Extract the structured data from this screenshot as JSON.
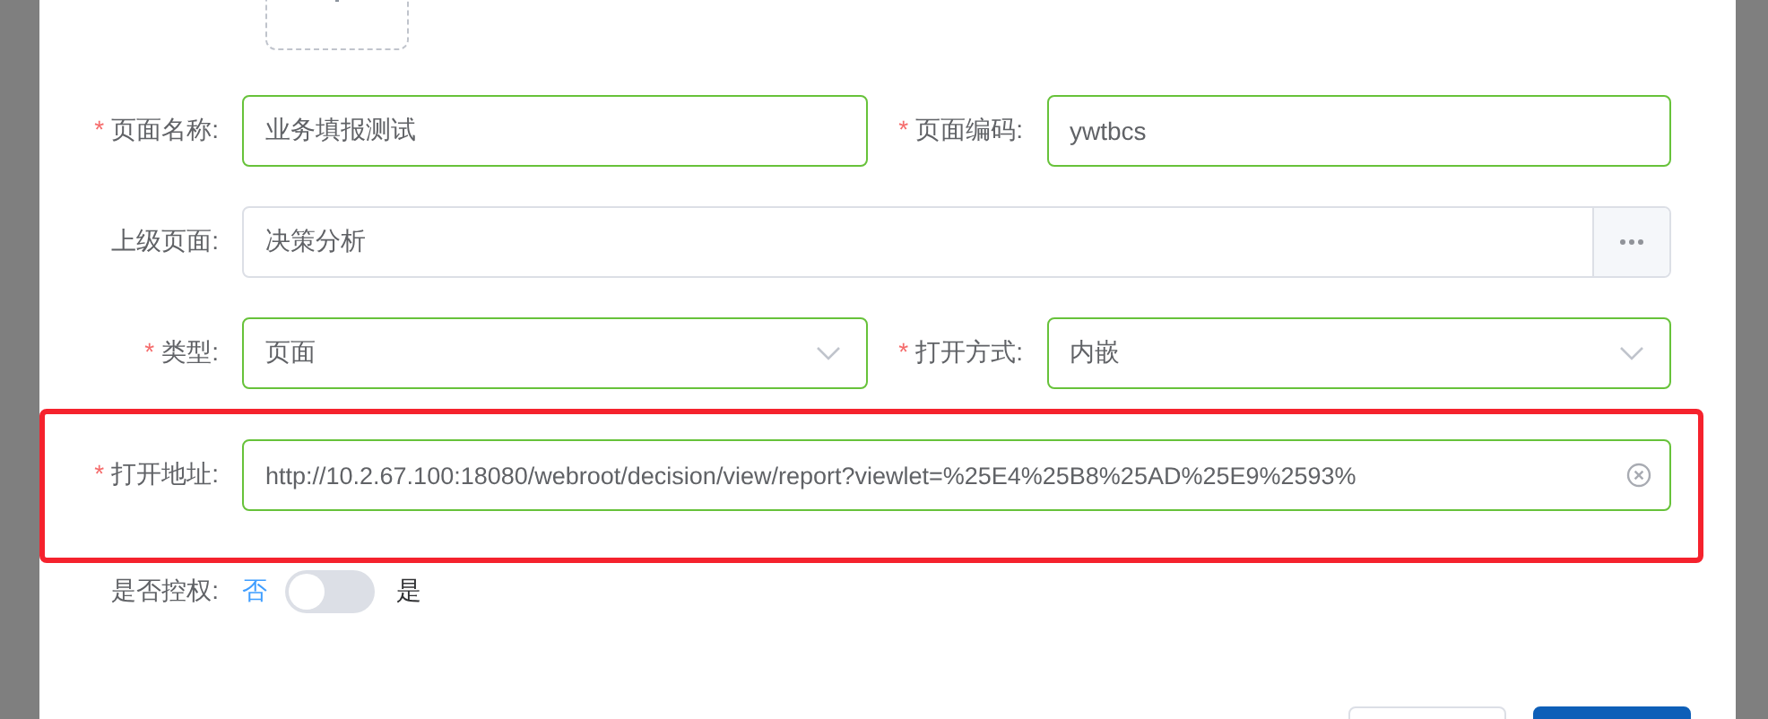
{
  "rows": [
    {
      "highlighted": false,
      "fields": [
        {
          "kind": "input",
          "label": "页面名称:",
          "required_mark": "*",
          "validated": true,
          "value": "业务填报测试"
        },
        {
          "kind": "input",
          "label": "页面编码:",
          "required_mark": "*",
          "validated": true,
          "value": "ywtbcs"
        }
      ]
    },
    {
      "highlighted": false,
      "fields": [
        {
          "kind": "picker",
          "label": "上级页面:",
          "validated": false,
          "value": "决策分析"
        }
      ]
    },
    {
      "highlighted": false,
      "fields": [
        {
          "kind": "select",
          "label": "类型:",
          "required_mark": "*",
          "validated": true,
          "value": "页面"
        },
        {
          "kind": "select",
          "label": "打开方式:",
          "required_mark": "*",
          "validated": true,
          "value": "内嵌"
        }
      ]
    },
    {
      "highlighted": true,
      "fields": [
        {
          "kind": "clearable",
          "label": "打开地址:",
          "required_mark": "*",
          "validated": true,
          "value": "http://10.2.67.100:18080/webroot/decision/view/report?viewlet=%25E4%25B8%25AD%25E9%2593%"
        }
      ]
    }
  ],
  "toggle": {
    "label": "是否控权:",
    "off_text": "否",
    "on_text": "是",
    "on": false
  }
}
